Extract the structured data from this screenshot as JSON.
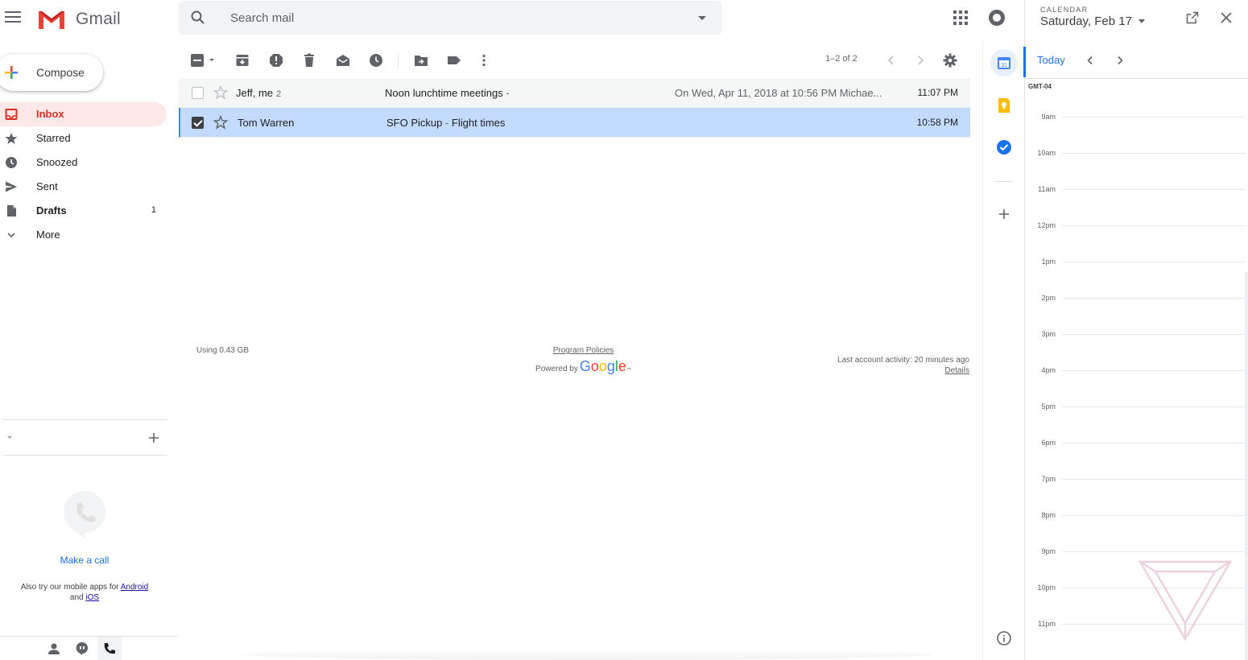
{
  "app": {
    "name": "Gmail"
  },
  "search": {
    "placeholder": "Search mail"
  },
  "compose": {
    "label": "Compose"
  },
  "nav": [
    {
      "label": "Inbox",
      "count": "",
      "icon": "inbox-icon",
      "active": true
    },
    {
      "label": "Starred",
      "count": "",
      "icon": "star-icon"
    },
    {
      "label": "Snoozed",
      "count": "",
      "icon": "clock-icon"
    },
    {
      "label": "Sent",
      "count": "",
      "icon": "send-icon"
    },
    {
      "label": "Drafts",
      "count": "1",
      "icon": "draft-icon"
    },
    {
      "label": "More",
      "count": "",
      "icon": "chevron-down-icon"
    }
  ],
  "toolbar": {
    "count": "1–2 of 2",
    "icons": [
      "select-all-icon",
      "archive-icon",
      "report-spam-icon",
      "delete-icon",
      "mark-read-icon",
      "snooze-icon",
      "move-to-icon",
      "label-icon",
      "more-vert-icon",
      "prev-page-icon",
      "next-page-icon",
      "settings-icon"
    ]
  },
  "emails": [
    {
      "sender": "Jeff, me",
      "thread_count": "2",
      "subject": "Noon lunchtime meetings",
      "separator": "-",
      "snippet": "On Wed, Apr 11, 2018 at 10:56 PM Michae...",
      "time": "11:07 PM",
      "selected": false
    },
    {
      "sender": "Tom Warren",
      "thread_count": "",
      "subject": "SFO Pickup",
      "separator": " - ",
      "snippet": "Flight times",
      "time": "10:58 PM",
      "selected": true
    }
  ],
  "footer": {
    "usage": "Using 0.43 GB",
    "policies": "Program Policies",
    "powered_by": "Powered by",
    "activity": "Last account activity: 20 minutes ago",
    "details": "Details"
  },
  "hangouts": {
    "make_call": "Make a call",
    "mobile_prefix": "Also try our mobile apps for",
    "android": "Android",
    "and": "and",
    "ios": "iOS"
  },
  "calendar": {
    "label": "CALENDAR",
    "date": "Saturday, Feb 17",
    "today": "Today",
    "timezone": "GMT-04",
    "hours": [
      "9am",
      "10am",
      "11am",
      "12pm",
      "1pm",
      "2pm",
      "3pm",
      "4pm",
      "5pm",
      "6pm",
      "7pm",
      "8pm",
      "9pm",
      "10pm",
      "11pm"
    ]
  },
  "colors": {
    "accent_red": "#d93025",
    "inbox_active_bg": "#fce8e6",
    "selected_row": "#c2dbff",
    "link_blue": "#1a73e8"
  }
}
